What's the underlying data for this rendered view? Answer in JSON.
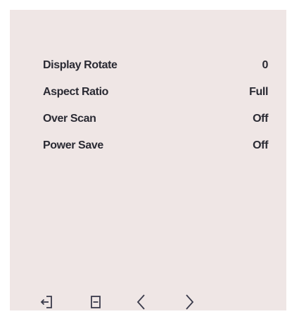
{
  "settings": [
    {
      "label": "Display Rotate",
      "value": "0"
    },
    {
      "label": "Aspect Ratio",
      "value": "Full"
    },
    {
      "label": "Over Scan",
      "value": "Off"
    },
    {
      "label": "Power Save",
      "value": "Off"
    }
  ],
  "bottom_bar": {
    "buttons": [
      {
        "icon": "exit-icon"
      },
      {
        "icon": "menu-select-icon"
      },
      {
        "icon": "chevron-left-icon"
      },
      {
        "icon": "chevron-right-icon"
      }
    ]
  },
  "colors": {
    "panel_background": "#efe6e5",
    "text": "#2a2a33",
    "icon": "#3a3a4a"
  }
}
